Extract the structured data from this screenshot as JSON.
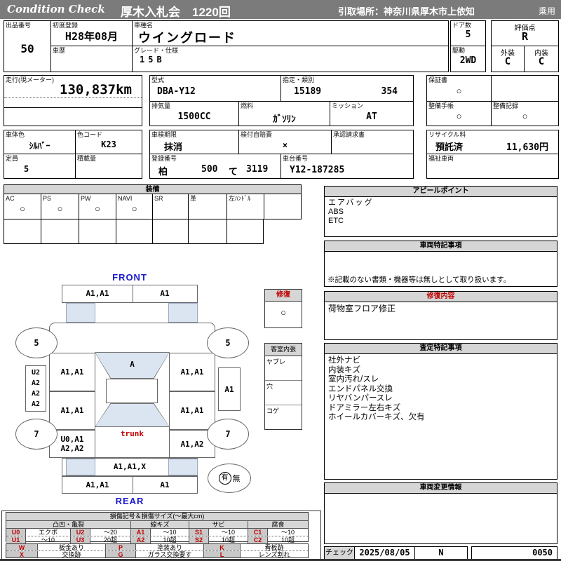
{
  "header": {
    "brand": "Condition Check",
    "auction": "厚木入札会　1220回",
    "pickup": "引取場所：神奈川県厚木市上依知",
    "vehicle_type": "乗用"
  },
  "info": {
    "lot": {
      "label": "出品番号",
      "value": "50"
    },
    "first_reg": {
      "label": "初度登録",
      "value": "H28年08月"
    },
    "history": {
      "label": "車歴",
      "value": ""
    },
    "model_name": {
      "label": "車種名",
      "value": "ウイングロード"
    },
    "grade": {
      "label": "グレード・仕様",
      "value": "15B"
    },
    "doors": {
      "label": "ドア数",
      "value": "5"
    },
    "score": {
      "label": "評価点",
      "value": "R"
    },
    "drive": {
      "label": "駆動",
      "value": "2WD"
    },
    "exterior": {
      "label": "外装",
      "value": "C"
    },
    "interior": {
      "label": "内装",
      "value": "C"
    },
    "mileage": {
      "label": "走行(現メーター)",
      "value": "130,837km"
    },
    "model_code": {
      "label": "型式",
      "value": "DBA-Y12"
    },
    "designation": {
      "label": "指定・類別",
      "value1": "15189",
      "value2": "354"
    },
    "warranty": {
      "label": "保証書",
      "value": "○"
    },
    "displacement": {
      "label": "排気量",
      "value": "1500CC"
    },
    "fuel": {
      "label": "燃料",
      "value": "ｶﾞｿﾘﾝ"
    },
    "transmission": {
      "label": "ミッション",
      "value": "AT"
    },
    "maintenance_book": {
      "label": "整備手帳",
      "value": "○"
    },
    "maintenance_record": {
      "label": "整備記録",
      "value": "○"
    },
    "body_color": {
      "label": "車体色",
      "value": "ｼﾙﾊﾞｰ"
    },
    "color_code": {
      "label": "色コード",
      "value": "K23"
    },
    "inspection": {
      "label": "車検期限",
      "value": "抹消"
    },
    "insurance": {
      "label": "検付自賠責",
      "value": "×"
    },
    "approval": {
      "label": "承認請求書",
      "value": ""
    },
    "recycle": {
      "label": "リサイクル料",
      "status": "預託済",
      "fee": "11,630円"
    },
    "capacity": {
      "label": "定員",
      "value": "5"
    },
    "load": {
      "label": "積載量",
      "value": ""
    },
    "registration": {
      "label": "登録番号",
      "area": "柏",
      "class": "500",
      "kana": "て",
      "number": "3119"
    },
    "chassis": {
      "label": "車台番号",
      "value": "Y12-187285"
    },
    "welfare": {
      "label": "福祉車両",
      "value": ""
    }
  },
  "equipment": {
    "title": "装備",
    "items": [
      {
        "label": "AC",
        "value": "○"
      },
      {
        "label": "PS",
        "value": "○"
      },
      {
        "label": "PW",
        "value": "○"
      },
      {
        "label": "NAVI",
        "value": "○"
      },
      {
        "label": "SR",
        "value": ""
      },
      {
        "label": "革",
        "value": ""
      },
      {
        "label": "左ﾊﾝﾄﾞﾙ",
        "value": ""
      },
      {
        "label": "",
        "value": ""
      }
    ]
  },
  "appeal": {
    "title": "アピールポイント",
    "lines": [
      "エアバッグ",
      "ABS",
      "ETC"
    ]
  },
  "special_notes": {
    "title": "車両特記事項",
    "footnote": "※記載のない書類・機器等は無しとして取り扱います。"
  },
  "repair_detail": {
    "title": "修復内容",
    "lines": [
      "荷物室フロア修正"
    ]
  },
  "assessment": {
    "title": "査定特記事項",
    "lines": [
      "社外ナビ",
      "内装キズ",
      "室内汚れ/スレ",
      "エンドパネル交換",
      "リヤバンパースレ",
      "ドアミラー左右キズ",
      "ホイールカバーキズ、欠有"
    ]
  },
  "change_info": {
    "title": "車両変更情報"
  },
  "check": {
    "label": "チェック",
    "date": "2025/08/05",
    "flag": "N",
    "number": "0050"
  },
  "diagram": {
    "front_label": "FRONT",
    "rear_label": "REAR",
    "trunk_label": "trunk",
    "repair_box": {
      "title": "修復",
      "mark": "○"
    },
    "cabin_box": {
      "title": "客室内張",
      "rows": [
        "ヤブレ",
        "穴",
        "コゲ"
      ]
    },
    "spare_tire": {
      "present": "有",
      "absent": "無"
    },
    "marks": {
      "front_bumper_left": "A1,A1",
      "front_bumper_right": "A1",
      "front_left_tire": "5",
      "front_right_tire": "5",
      "rear_left_tire": "7",
      "rear_right_tire": "7",
      "left_side": [
        "U2",
        "A2",
        "A2",
        "A2"
      ],
      "right_side": "A1",
      "front_left_door": "A1,A1",
      "rear_left_door": "A1,A1",
      "left_quarter": [
        "U0,A1",
        "A2,A2"
      ],
      "windshield": "A",
      "front_right_door": "A1,A1",
      "rear_right_door": "A1,A1",
      "right_quarter": "A1,A2",
      "rear_panel": "A1,A1,X",
      "rear_bumper_left": "A1,A1",
      "rear_bumper_right": "A1"
    }
  },
  "legend": {
    "title": "損傷記号＆損傷サイズ(〜最大cm)",
    "groups": [
      "凸凹・亀裂",
      "線キズ",
      "サビ",
      "腐食"
    ],
    "rows": [
      [
        "U0",
        "エクボ",
        "U2",
        "〜20",
        "A1",
        "〜10",
        "S1",
        "〜10",
        "C1",
        "〜10"
      ],
      [
        "U1",
        "〜10",
        "U3",
        "20超",
        "A2",
        "10超",
        "S2",
        "10超",
        "C2",
        "10超"
      ]
    ],
    "rows2": [
      [
        "W",
        "板金あり",
        "P",
        "塗装あり",
        "K",
        "看板跡"
      ],
      [
        "X",
        "交換跡",
        "G",
        "ガラス交換要す",
        "L",
        "レンズ割れ"
      ]
    ]
  },
  "colors": {
    "header_bg": "#7b7b7b",
    "section_header_bg": "#d6d6d6",
    "glass_blue": "#dbe5f1",
    "accent_red": "#c00000",
    "accent_blue": "#1a1acd"
  }
}
